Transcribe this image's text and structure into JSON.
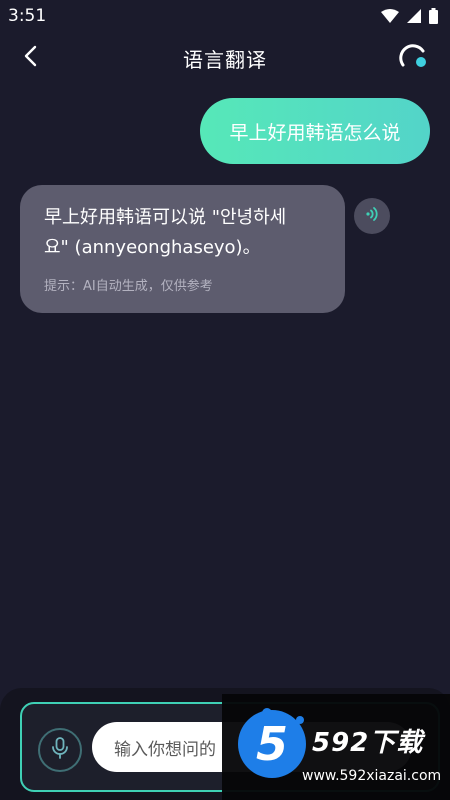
{
  "status_bar": {
    "time": "3:51"
  },
  "header": {
    "title": "语言翻译"
  },
  "chat": {
    "user_message": "早上好用韩语怎么说",
    "ai_message_line1": "早上好用韩语可以说 \"안녕하세",
    "ai_message_line2": "요\" (annyeonghaseyo)。",
    "ai_hint": "提示：AI自动生成，仅供参考"
  },
  "input": {
    "placeholder": "输入你想问的"
  },
  "watermark": {
    "logo_number": "5",
    "title": "592下载",
    "url": "www.592xiazai.com"
  },
  "colors": {
    "background": "#1b1b2c",
    "user_bubble": "#56e8b8",
    "ai_bubble": "#5d5c6e",
    "accent": "#3fd0b5"
  }
}
